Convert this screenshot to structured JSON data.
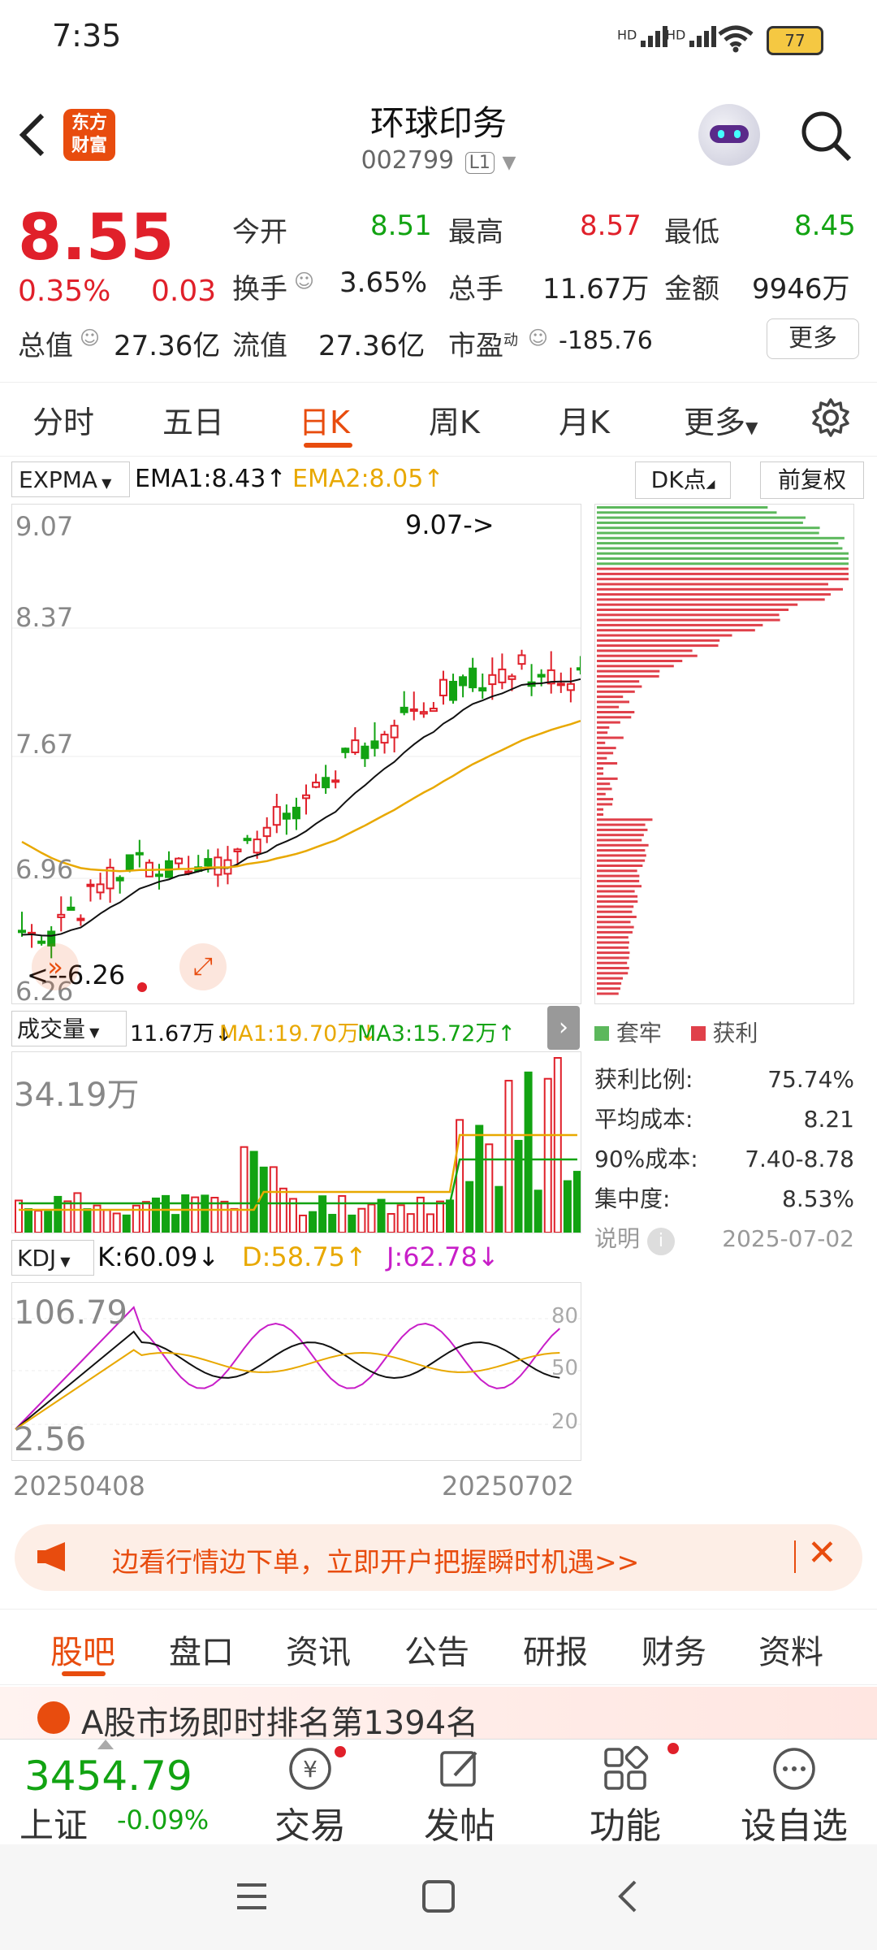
{
  "status_bar": {
    "time": "7:35",
    "battery": "77",
    "signal_labels": [
      "HD",
      "HD"
    ]
  },
  "header": {
    "title": "环球印务",
    "code": "002799",
    "level": "L1",
    "brand_logo_text": "东方\n财富"
  },
  "quote": {
    "price": "8.55",
    "change_pct": "0.35%",
    "change": "0.03",
    "open_label": "今开",
    "open": "8.51",
    "high_label": "最高",
    "high": "8.57",
    "low_label": "最低",
    "low": "8.45",
    "turnover_label": "换手",
    "turnover": "3.65%",
    "volume_label": "总手",
    "volume": "11.67万",
    "amount_label": "金额",
    "amount": "9946万",
    "mcap_label": "总值",
    "mcap": "27.36亿",
    "float_label": "流值",
    "float": "27.36亿",
    "pe_label": "市盈",
    "pe_sup": "动",
    "pe": "-185.76",
    "more": "更多"
  },
  "tabs": [
    "分时",
    "五日",
    "日K",
    "周K",
    "月K",
    "更多"
  ],
  "kline": {
    "indicator": "EXPMA",
    "ema1": "EMA1:8.43↑",
    "ema2": "EMA2:8.05↑",
    "dk_label": "DK点",
    "adjust_label": "前复权",
    "y_labels": [
      "9.07",
      "8.37",
      "7.67",
      "6.96",
      "6.26"
    ],
    "max_annot": "9.07->",
    "min_annot": "<--6.26"
  },
  "chips": {
    "legend_trapped": "套牢",
    "legend_profit": "获利",
    "rows": [
      {
        "label": "获利比例:",
        "value": "75.74%"
      },
      {
        "label": "平均成本:",
        "value": "8.21"
      },
      {
        "label": "90%成本:",
        "value": "7.40-8.78"
      },
      {
        "label": "集中度:",
        "value": "8.53%"
      }
    ],
    "note_label": "说明",
    "date": "2025-07-02",
    "colors": {
      "trapped": "#5cb85c",
      "profit": "#e0404a"
    }
  },
  "volume": {
    "indicator": "成交量",
    "vol": "11.67万↓",
    "ma1": "MA1:19.70万↓",
    "ma3": "MA3:15.72万↑",
    "max_label": "34.19万"
  },
  "kdj": {
    "indicator": "KDJ",
    "k": "K:60.09↓",
    "d": "D:58.75↑",
    "j": "J:62.78↓",
    "y_top": "106.79",
    "y_bottom": "2.56",
    "levels": [
      "80",
      "50",
      "20"
    ],
    "date_start": "20250408",
    "date_end": "20250702"
  },
  "banner": {
    "text": "边看行情边下单，立即开户把握瞬时机遇>>"
  },
  "bottom_tabs": [
    "股吧",
    "盘口",
    "资讯",
    "公告",
    "研报",
    "财务",
    "资料"
  ],
  "rank_text": "A股市场即时排名第1394名",
  "bottom_nav": {
    "index_value": "3454.79",
    "index_name": "上证",
    "index_change": "-0.09%",
    "items": [
      "交易",
      "发帖",
      "功能",
      "设自选"
    ]
  },
  "colors": {
    "up": "#e0202a",
    "down": "#12a312",
    "accent": "#e84c0e"
  }
}
